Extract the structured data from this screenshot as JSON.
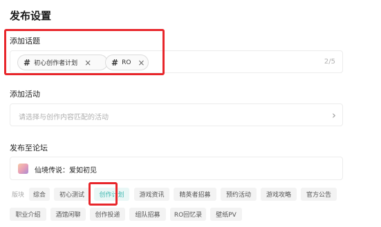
{
  "page": {
    "title": "发布设置"
  },
  "topics": {
    "label": "添加话题",
    "tags": [
      {
        "hash": "#",
        "text": "初心创作者计划"
      },
      {
        "hash": "#",
        "text": "RO"
      }
    ],
    "count": "2/5"
  },
  "activity": {
    "label": "添加活动",
    "placeholder": "请选择与创作内容匹配的活动"
  },
  "forum": {
    "label": "发布至论坛",
    "game_name": "仙境传说：爱如初见"
  },
  "boards": {
    "label": "版块",
    "chips": [
      "综合",
      "初心测试",
      "创作计划",
      "游戏资讯",
      "精英者招募",
      "预约活动",
      "游戏攻略",
      "官方公告",
      "职业介绍",
      "酒馆闲聊",
      "创作投递",
      "组队招募",
      "RO回忆录",
      "壁纸PV"
    ],
    "selected": "创作计划"
  },
  "colors": {
    "highlight": "#e8262b",
    "accent": "#3fb7b0"
  }
}
